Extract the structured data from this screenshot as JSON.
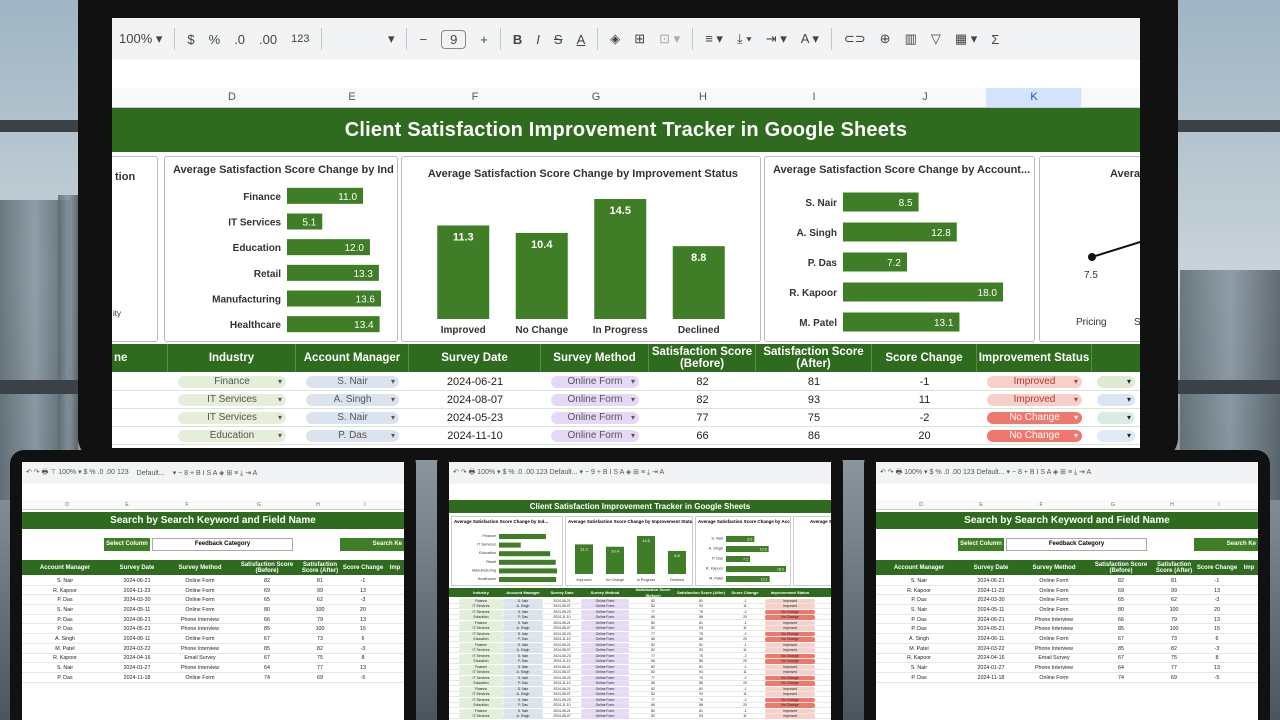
{
  "toolbar": {
    "zoom": "100%",
    "currency": "$",
    "percent": "%",
    "decimal_decrease": ".0",
    "decimal_increase": ".00",
    "number_format": "123",
    "font_size": "9",
    "minus": "−",
    "plus": "+",
    "bold": "B",
    "italic": "I",
    "strikethrough": "S",
    "text_color": "A",
    "sum": "Σ"
  },
  "columns": [
    "D",
    "E",
    "F",
    "G",
    "H",
    "I",
    "J",
    "K"
  ],
  "selected_column": "K",
  "title": "Client Satisfaction Improvement Tracker in Google Sheets",
  "charts": {
    "industry": {
      "title": "Average Satisfaction Score Change by Ind...",
      "type": "bar",
      "categories": [
        "Finance",
        "IT Services",
        "Education",
        "Retail",
        "Manufacturing",
        "Healthcare"
      ],
      "values": [
        11.0,
        5.1,
        12.0,
        13.3,
        13.6,
        13.4
      ],
      "labels": [
        "11.0",
        "5.1",
        "12.0",
        "13.3",
        "13.6",
        "13.4"
      ]
    },
    "status": {
      "title": "Average Satisfaction Score Change by Improvement Status",
      "type": "bar",
      "categories": [
        "Improved",
        "No Change",
        "In Progress",
        "Declined"
      ],
      "values": [
        11.3,
        10.4,
        14.5,
        8.8
      ],
      "labels": [
        "11.3",
        "10.4",
        "14.5",
        "8.8"
      ]
    },
    "manager": {
      "title": "Average Satisfaction Score Change by Account...",
      "type": "bar",
      "categories": [
        "S. Nair",
        "A. Singh",
        "P. Das",
        "R. Kapoor",
        "M. Patel"
      ],
      "values": [
        8.5,
        12.8,
        7.2,
        18.0,
        13.1
      ],
      "labels": [
        "8.5",
        "12.8",
        "7.2",
        "18.0",
        "13.1"
      ]
    },
    "method": {
      "title": "Average S",
      "type": "line",
      "point_label": "7.5",
      "x_label": "Pricing",
      "x_label_2": "S"
    },
    "partial_left_label": "tion",
    "partial_left_label_2": "ity"
  },
  "chart_data": [
    {
      "type": "bar",
      "title": "Average Satisfaction Score Change by Ind...",
      "categories": [
        "Finance",
        "IT Services",
        "Education",
        "Retail",
        "Manufacturing",
        "Healthcare"
      ],
      "values": [
        11.0,
        5.1,
        12.0,
        13.3,
        13.6,
        13.4
      ]
    },
    {
      "type": "bar",
      "title": "Average Satisfaction Score Change by Improvement Status",
      "categories": [
        "Improved",
        "No Change",
        "In Progress",
        "Declined"
      ],
      "values": [
        11.3,
        10.4,
        14.5,
        8.8
      ]
    },
    {
      "type": "bar",
      "title": "Average Satisfaction Score Change by Account...",
      "categories": [
        "S. Nair",
        "A. Singh",
        "P. Das",
        "R. Kapoor",
        "M. Patel"
      ],
      "values": [
        8.5,
        12.8,
        7.2,
        18.0,
        13.1
      ]
    }
  ],
  "table": {
    "headers": {
      "partial": "ne",
      "industry": "Industry",
      "manager": "Account Manager",
      "date": "Survey Date",
      "method": "Survey Method",
      "before": "Satisfaction Score (Before)",
      "after": "Satisfaction Score (After)",
      "change": "Score Change",
      "status": "Improvement Status"
    },
    "rows": [
      {
        "industry": "Finance",
        "manager": "S. Nair",
        "date": "2024-06-21",
        "method": "Online Form",
        "before": "82",
        "after": "81",
        "change": "-1",
        "status": "Improved"
      },
      {
        "industry": "IT Services",
        "manager": "A. Singh",
        "date": "2024-08-07",
        "method": "Online Form",
        "before": "82",
        "after": "93",
        "change": "11",
        "status": "Improved"
      },
      {
        "industry": "IT Services",
        "manager": "S. Nair",
        "date": "2024-05-23",
        "method": "Online Form",
        "before": "77",
        "after": "75",
        "change": "-2",
        "status": "No Change"
      },
      {
        "industry": "Education",
        "manager": "P. Das",
        "date": "2024-11-10",
        "method": "Online Form",
        "before": "66",
        "after": "86",
        "change": "20",
        "status": "No Change"
      }
    ]
  },
  "tablet_left": {
    "title": "Search by Search Keyword and Field Name",
    "select_label": "Select Column",
    "select_value": "Feedback Category",
    "search_label": "Search Ke",
    "font_name": "Default...",
    "columns": [
      "D",
      "E",
      "F",
      "G",
      "H",
      "I"
    ],
    "headers": [
      "Account Manager",
      "Survey Date",
      "Survey Method",
      "Satisfaction Score (Before)",
      "Satisfaction Score (After)",
      "Score Change",
      "Imp"
    ],
    "rows": [
      [
        "S. Nair",
        "2024-06-21",
        "Online Form",
        "82",
        "81",
        "-1"
      ],
      [
        "R. Kapoor",
        "2024-11-23",
        "Online Form",
        "69",
        "99",
        "13"
      ],
      [
        "P. Das",
        "2024-03-30",
        "Online Form",
        "65",
        "62",
        "-3"
      ],
      [
        "S. Nair",
        "2024-05-11",
        "Online Form",
        "80",
        "100",
        "20"
      ],
      [
        "P. Das",
        "2024-06-21",
        "Phone Interview",
        "66",
        "79",
        "13"
      ],
      [
        "P. Das",
        "2024-05-21",
        "Phone Interview",
        "85",
        "100",
        "15"
      ],
      [
        "A. Singh",
        "2024-06-11",
        "Online Form",
        "67",
        "73",
        "6"
      ],
      [
        "M. Patel",
        "2024-03-22",
        "Phone Interview",
        "85",
        "82",
        "-3"
      ],
      [
        "R. Kapoor",
        "2024-04-16",
        "Email Survey",
        "67",
        "75",
        "8"
      ],
      [
        "S. Nair",
        "2024-01-27",
        "Phone Interview",
        "64",
        "77",
        "13"
      ],
      [
        "P. Das",
        "2024-11-18",
        "Online Form",
        "74",
        "69",
        "-5"
      ]
    ]
  },
  "tablet_middle": {
    "title": "Client Satisfaction Improvement Tracker in Google Sheets",
    "chart_titles": [
      "Average Satisfaction Score Change by Ind...",
      "Average Satisfaction Score Change by Improvement Status",
      "Average Satisfaction Score Change by Account...",
      "Average S"
    ],
    "headers": [
      "Industry",
      "Account Manager",
      "Survey Date",
      "Survey Method",
      "Satisfaction Score (Before)",
      "Satisfaction Score (After)",
      "Score Change",
      "Improvement Status"
    ]
  },
  "tablet_right": {
    "title": "Search by Search Keyword and Field Name",
    "select_label": "Select Column",
    "select_value": "Feedback Category",
    "search_label": "Search Ke"
  },
  "colors": {
    "green_dark": "#2e6b1e",
    "green_bar": "#3f7d26",
    "chip_industry": "#e3efd8",
    "chip_manager": "#dbe4ee",
    "chip_method": "#e6d8f7",
    "chip_improved": "#f8d0cb",
    "chip_nochange": "#f0776c"
  }
}
